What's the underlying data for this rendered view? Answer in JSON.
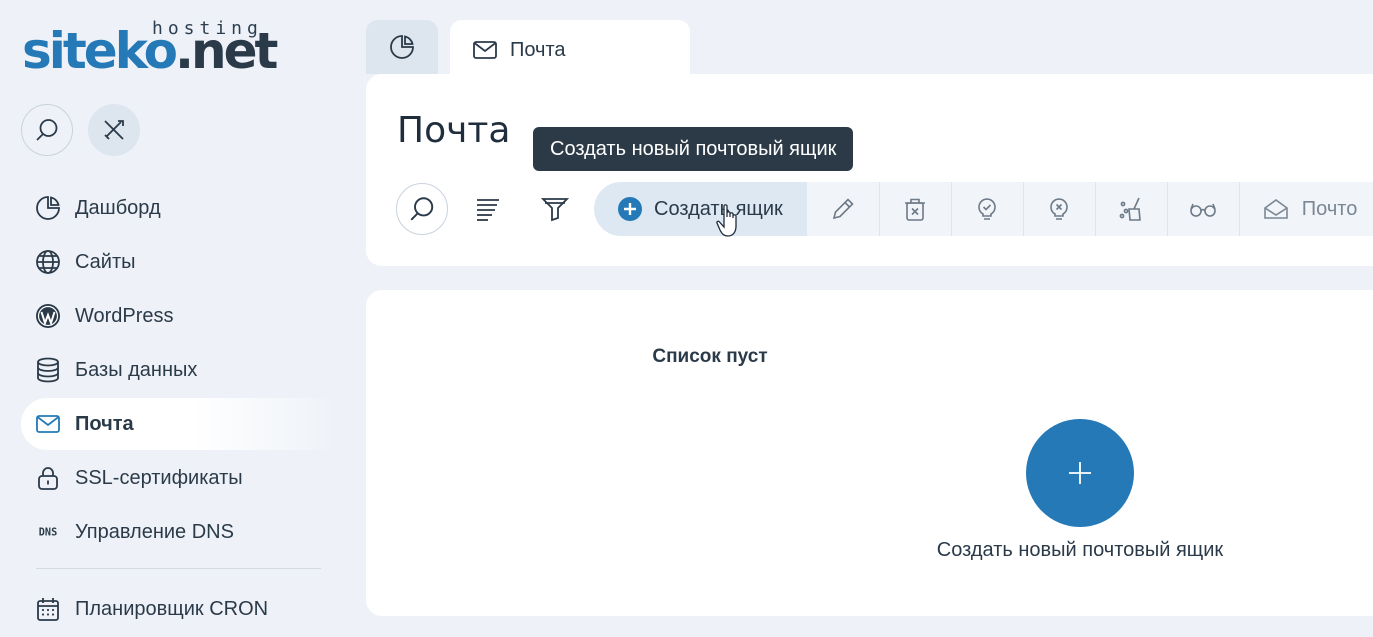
{
  "logo": {
    "brand_blue": "siteko",
    "brand_dot": ".",
    "brand_dark": "net",
    "hosting": "hosting"
  },
  "sidebar": {
    "items": [
      {
        "label": "Дашборд",
        "icon": "pie-chart-icon"
      },
      {
        "label": "Сайты",
        "icon": "globe-icon"
      },
      {
        "label": "WordPress",
        "icon": "wordpress-icon"
      },
      {
        "label": "Базы данных",
        "icon": "database-icon"
      },
      {
        "label": "Почта",
        "icon": "envelope-icon",
        "active": true
      },
      {
        "label": "SSL-сертификаты",
        "icon": "lock-icon"
      },
      {
        "label": "Управление DNS",
        "icon": "dns-icon",
        "icon_text": "DNS"
      },
      {
        "label": "Планировщик CRON",
        "icon": "calendar-icon"
      }
    ]
  },
  "tabs": [
    {
      "icon": "pie-chart-icon",
      "label": ""
    },
    {
      "icon": "envelope-icon",
      "label": "Почта"
    }
  ],
  "page": {
    "title": "Почта"
  },
  "tooltip": "Создать новый почтовый ящик",
  "toolbar": {
    "create_label": "Создать ящик",
    "cut_label": "Почто"
  },
  "empty_state": {
    "title": "Список пуст",
    "action_label": "Создать новый почтовый ящик"
  },
  "colors": {
    "accent": "#2479b6",
    "dark": "#2b3a49",
    "tooltip_bg": "#2c3a47"
  }
}
